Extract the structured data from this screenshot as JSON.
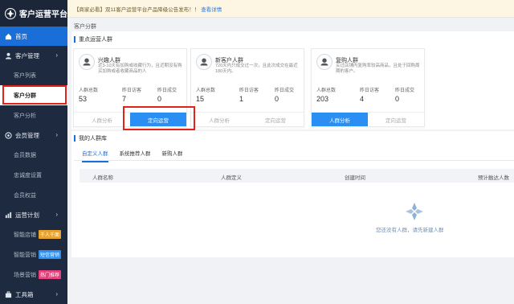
{
  "app": {
    "title": "客户运营平台"
  },
  "notice": {
    "text": "【商家必看】双11客户运营平台产品降级公告发布！！",
    "link": "查看详情"
  },
  "sidebar": {
    "home": "首页",
    "customer_mgmt": "客户管理",
    "customer_list": "客户列表",
    "customer_segment": "客户分群",
    "customer_analysis": "客户分析",
    "member_mgmt": "会员管理",
    "member_data": "会员数据",
    "loyalty_settings": "忠诚度设置",
    "member_rights": "会员权益",
    "ops_plan": "运营计划",
    "smart_store": "智能店铺",
    "smart_store_tag": "千人千面",
    "smart_marketing": "智能营销",
    "smart_marketing_tag": "短信营销",
    "scene_marketing": "场景营销",
    "scene_marketing_tag": "热门推荐",
    "toolbox": "工具箱"
  },
  "main": {
    "breadcrumb": "客户分群",
    "key_section": "重点运营人群",
    "my_section": "我的人群库",
    "cards": [
      {
        "title": "兴趣人群",
        "desc": "近3-10天有加购或收藏行为，且近期没有购买加购或者收藏商品的人",
        "stat1_label": "人群总数",
        "stat1_value": "53",
        "stat2_label": "昨日访客",
        "stat2_value": "7",
        "stat3_label": "昨日成交",
        "stat3_value": "0",
        "btn_analysis": "人群分析",
        "btn_ops": "定向运营"
      },
      {
        "title": "新客户人群",
        "desc": "720天内只成交过一次，且此次成交在最近180天内。",
        "stat1_label": "人群总数",
        "stat1_value": "15",
        "stat2_label": "昨日访客",
        "stat2_value": "1",
        "stat3_label": "昨日成交",
        "stat3_value": "0",
        "btn_analysis": "人群分析",
        "btn_ops": "定向运营"
      },
      {
        "title": "复购人群",
        "desc": "买过店铺内复购率较高商品，且处于回购周期的客户。",
        "stat1_label": "人群总数",
        "stat1_value": "203",
        "stat2_label": "昨日访客",
        "stat2_value": "4",
        "stat3_label": "昨日成交",
        "stat3_value": "0",
        "btn_analysis": "人群分析",
        "btn_ops": "定向运营"
      }
    ],
    "tabs": [
      "自定义人群",
      "系统推荐人群",
      "新购人群"
    ],
    "table_headers": [
      "人群名称",
      "人群定义",
      "创建时间",
      "预计触达人数"
    ],
    "empty_text": "您还没有人群，请先新建人群"
  },
  "colors": {
    "accent": "#1a6ed8",
    "sidebar": "#1e2a3f",
    "highlight": "#e2231a"
  }
}
